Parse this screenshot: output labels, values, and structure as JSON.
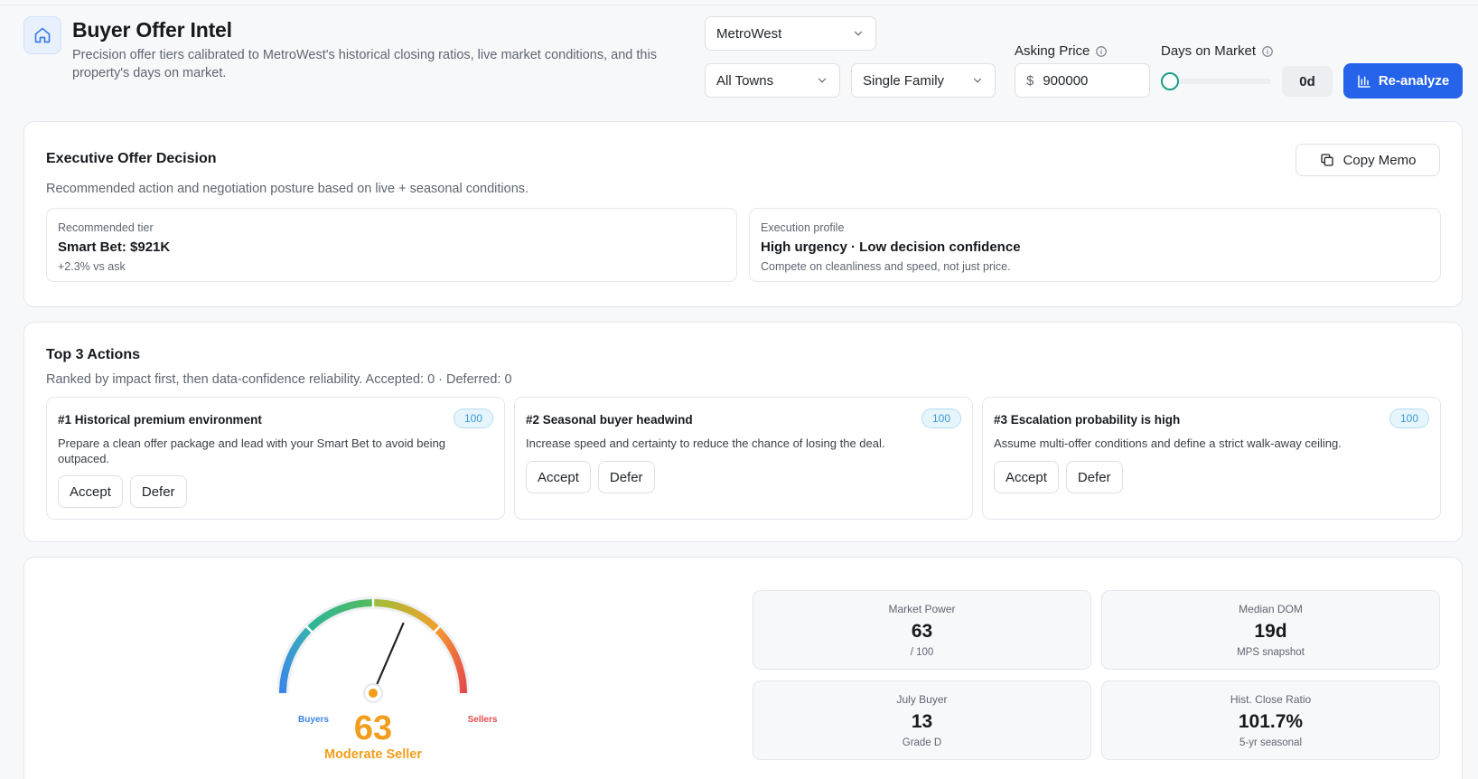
{
  "header": {
    "title": "Buyer Offer Intel",
    "subtitle": "Precision offer tiers calibrated to MetroWest's historical closing ratios, live market conditions, and this property's days on market."
  },
  "filters": {
    "region": "MetroWest",
    "town": "All Towns",
    "property_type": "Single Family",
    "asking_price_label": "Asking Price",
    "currency_symbol": "$",
    "asking_price_value": "900000",
    "days_on_market_label": "Days on Market",
    "days_on_market_value": "0d",
    "days_on_market_fraction": 0,
    "reanalyze_label": "Re-analyze"
  },
  "executive": {
    "title": "Executive Offer Decision",
    "description": "Recommended action and negotiation posture based on live + seasonal conditions.",
    "copy_label": "Copy Memo",
    "recommended": {
      "label": "Recommended tier",
      "value": "Smart Bet: $921K",
      "note": "+2.3% vs ask"
    },
    "execution": {
      "label": "Execution profile",
      "value": "High urgency · Low decision confidence",
      "note": "Compete on cleanliness and speed, not just price."
    }
  },
  "actions": {
    "title": "Top 3 Actions",
    "description": "Ranked by impact first, then data-confidence reliability. Accepted: 0 · Deferred: 0",
    "accept_label": "Accept",
    "defer_label": "Defer",
    "items": [
      {
        "title": "#1 Historical premium environment",
        "score": "100",
        "description": "Prepare a clean offer package and lead with your Smart Bet to avoid being outpaced."
      },
      {
        "title": "#2 Seasonal buyer headwind",
        "score": "100",
        "description": "Increase speed and certainty to reduce the chance of losing the deal."
      },
      {
        "title": "#3 Escalation probability is high",
        "score": "100",
        "description": "Assume multi-offer conditions and define a strict walk-away ceiling."
      }
    ]
  },
  "gauge": {
    "score": "63",
    "value": 63,
    "status": "Moderate Seller",
    "left_label": "Buyers",
    "right_label": "Sellers"
  },
  "stats": [
    {
      "label": "Market Power",
      "value": "63",
      "sub": "/ 100"
    },
    {
      "label": "Median DOM",
      "value": "19d",
      "sub": "MPS snapshot"
    },
    {
      "label": "July Buyer",
      "value": "13",
      "sub": "Grade D"
    },
    {
      "label": "Hist. Close Ratio",
      "value": "101.7%",
      "sub": "5-yr seasonal"
    }
  ],
  "colors": {
    "accent": "#2563eb",
    "gauge_value": "#f29d1c",
    "buyers": "#3a86e8",
    "sellers": "#e44a4a",
    "slider": "#1a9e86"
  }
}
